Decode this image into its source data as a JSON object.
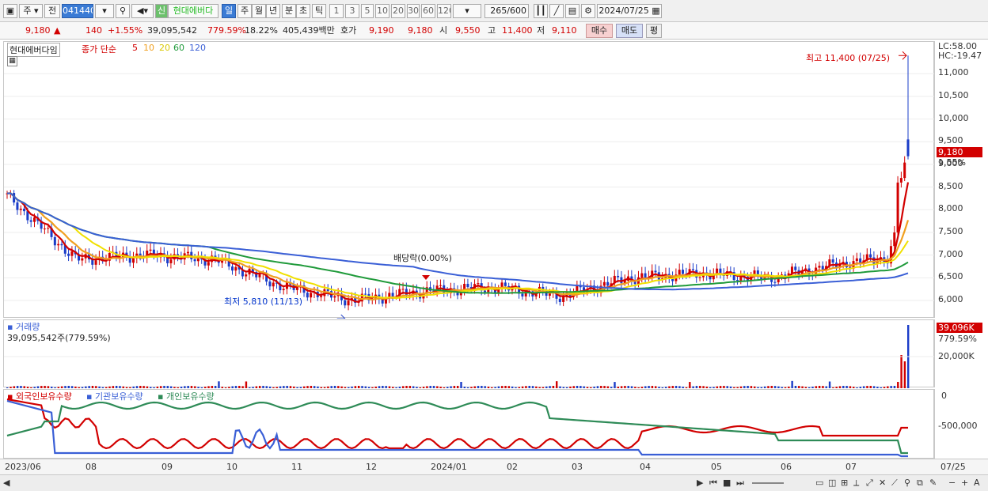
{
  "toolbar": {
    "market": "주",
    "prefix": "전",
    "code": "041440",
    "badge": "신",
    "name": "현대에버다",
    "periods": [
      "일",
      "주",
      "월",
      "년",
      "분",
      "초",
      "틱"
    ],
    "active_period": "일",
    "ticks": [
      "1",
      "3",
      "5",
      "10",
      "20",
      "30",
      "60",
      "120"
    ],
    "count": "265",
    "max": "/600",
    "date": "2024/07/25"
  },
  "quote": {
    "price": "9,180",
    "arrow": "▲",
    "change": "140",
    "pct": "+1.55%",
    "volume": "39,095,542",
    "vol_ratio": "779.59%",
    "turnover": "18.22%",
    "amount": "405,439백만",
    "hoga_label": "호가",
    "bid": "9,190",
    "ask": "9,180",
    "open_label": "시",
    "open": "9,550",
    "high_label": "고",
    "high": "11,400",
    "low_label": "저",
    "low": "9,110",
    "buy": "매수",
    "sell": "매도",
    "eval": "평"
  },
  "price_pane": {
    "name": "현대에버다임",
    "legend_label": "종가 단순",
    "ma": [
      "5",
      "10",
      "20",
      "60",
      "120"
    ],
    "ma_colors": [
      "#d20000",
      "#f0a020",
      "#f0e000",
      "#1f9a3a",
      "#3a5fd6"
    ],
    "high_note": "최고 11,400 (07/25)",
    "low_note": "최저 5,810 (11/13)",
    "dividend_note": "배당락(0.00%)",
    "lc": "LC:58.00",
    "hc": "HC:-19.47",
    "price_tag": "9,180",
    "pct_tag": "1.55%",
    "y_ticks": [
      "11,000",
      "10,500",
      "10,000",
      "9,500",
      "9,000",
      "8,500",
      "8,000",
      "7,500",
      "7,000",
      "6,500",
      "6,000"
    ],
    "y_values": [
      11000,
      10500,
      10000,
      9500,
      9000,
      8500,
      8000,
      7500,
      7000,
      6500,
      6000
    ]
  },
  "volume_pane": {
    "name": "거래량",
    "value": "39,095,542주(779.59%)",
    "tag": "39,096K",
    "tag_pct": "779.59%",
    "tick": "20,000K"
  },
  "holder_pane": {
    "legend": [
      "외국인보유수량",
      "기관보유수량",
      "개인보유수량"
    ],
    "colors": [
      "#d20000",
      "#3a5fd6",
      "#2e8b57"
    ],
    "ticks": [
      "0",
      "-500,000"
    ]
  },
  "x_axis": {
    "labels": [
      "2023/06",
      "08",
      "09",
      "10",
      "11",
      "12",
      "2024/01",
      "02",
      "03",
      "04",
      "05",
      "06",
      "07"
    ],
    "last": "07/25"
  },
  "chart_data": {
    "type": "candlestick",
    "ticker": "041440",
    "name": "현대에버다임",
    "ylim": [
      5600,
      11700
    ],
    "monthly_close": [
      {
        "x": "2023/06",
        "close": 8300
      },
      {
        "x": "2023/07",
        "close": 6900
      },
      {
        "x": "2023/08",
        "close": 7000
      },
      {
        "x": "2023/09",
        "close": 6900
      },
      {
        "x": "2023/10",
        "close": 6300
      },
      {
        "x": "2023/11",
        "close": 6000
      },
      {
        "x": "2023/12",
        "close": 6200
      },
      {
        "x": "2024/01",
        "close": 6300
      },
      {
        "x": "2024/02",
        "close": 6100
      },
      {
        "x": "2024/03",
        "close": 6500
      },
      {
        "x": "2024/04",
        "close": 6600
      },
      {
        "x": "2024/05",
        "close": 6500
      },
      {
        "x": "2024/06",
        "close": 6800
      },
      {
        "x": "2024/07",
        "close": 7000
      },
      {
        "x": "2024/07/25",
        "close": 9180
      }
    ],
    "last_candle": {
      "date": "2024/07/25",
      "open": 9550,
      "high": 11400,
      "low": 9110,
      "close": 9180,
      "volume": 39095542
    },
    "period_low": {
      "date": "11/13",
      "value": 5810
    },
    "period_high": {
      "date": "07/25",
      "value": 11400
    }
  }
}
